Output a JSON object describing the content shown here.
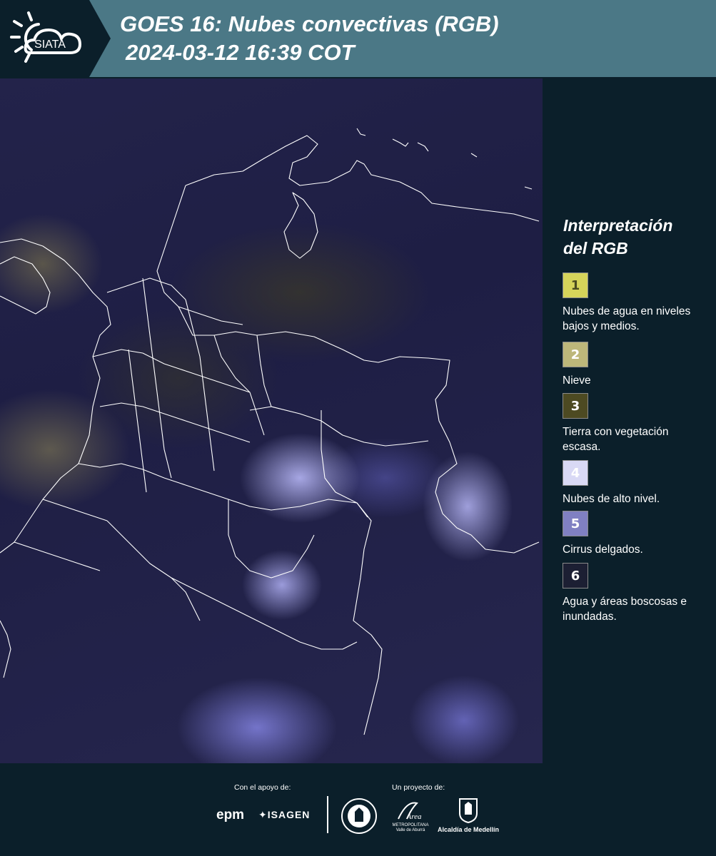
{
  "header": {
    "logo_text": "SIATA",
    "title_line1": "GOES 16: Nubes convectivas (RGB)",
    "title_line2": "2024-03-12 16:39 COT"
  },
  "legend": {
    "title_line1": "Interpretación",
    "title_line2": "del RGB",
    "items": [
      {
        "number": "1",
        "label": "Nubes de agua en niveles bajos y medios.",
        "color": "#d6d45a",
        "text_color": "#4a4a20"
      },
      {
        "number": "2",
        "label": "Nieve",
        "color": "#bdb77a",
        "text_color": "#ffffff"
      },
      {
        "number": "3",
        "label": "Tierra con vegetación escasa.",
        "color": "#4d4a22",
        "text_color": "#ffffff"
      },
      {
        "number": "4",
        "label": "Nubes de alto nivel.",
        "color": "#d9d9f5",
        "text_color": "#ffffff"
      },
      {
        "number": "5",
        "label": "Cirrus delgados.",
        "color": "#8080c2",
        "text_color": "#ffffff"
      },
      {
        "number": "6",
        "label": "Agua y áreas boscosas e inundadas.",
        "color": "#1c1f33",
        "text_color": "#ffffff"
      }
    ]
  },
  "footer": {
    "support_caption": "Con el apoyo de:",
    "project_caption": "Un proyecto de:",
    "sponsors": [
      "epm",
      "ISAGEN"
    ],
    "area_logo_text": "METROPOLITANA Valle de Aburrá",
    "alcaldia_text": "Alcaldía de Medellín"
  },
  "colors": {
    "header_bg": "#4b7886",
    "page_bg": "#0b1f2a",
    "border_lines": "#ffffff"
  }
}
